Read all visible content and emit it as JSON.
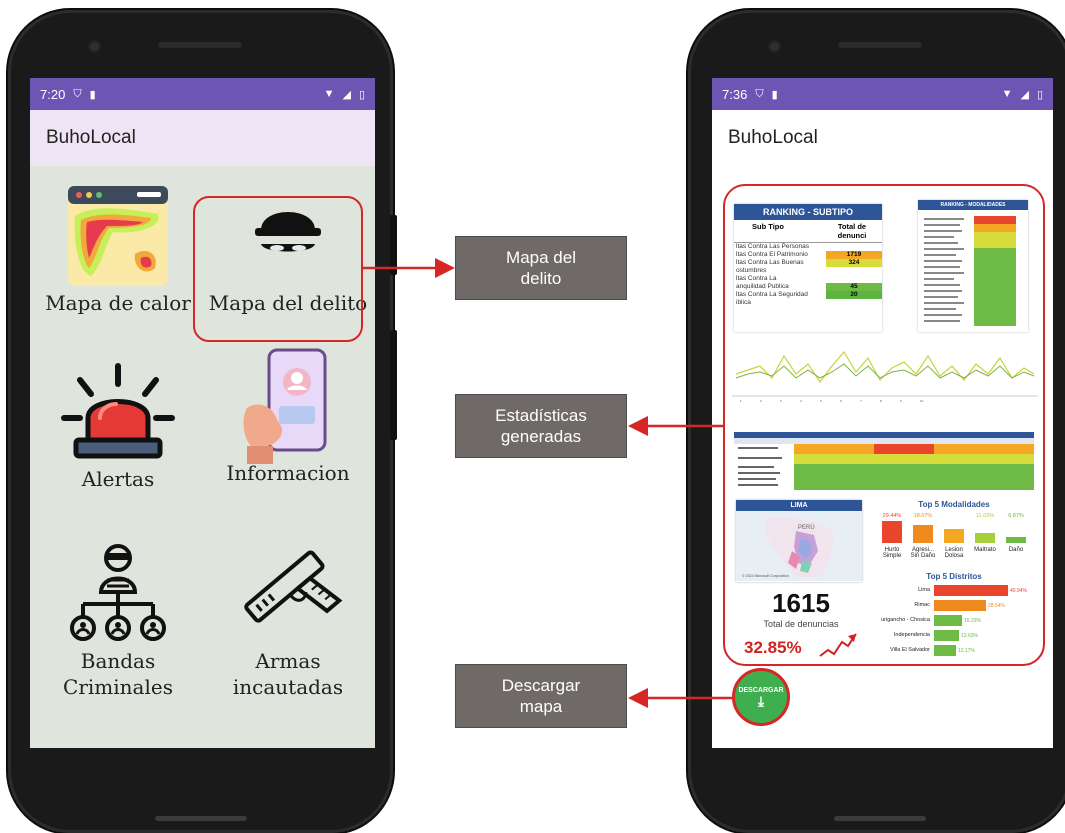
{
  "left_phone": {
    "status_time": "7:20",
    "app_title": "BuhoLocal",
    "tiles": [
      {
        "label": "Mapa de calor",
        "icon": "heatmap-icon"
      },
      {
        "label": "Mapa del delito",
        "icon": "thief-icon"
      },
      {
        "label": "Alertas",
        "icon": "siren-icon"
      },
      {
        "label": "Informacion",
        "icon": "phone-profile-icon"
      },
      {
        "label_line1": "Bandas",
        "label_line2": "Criminales",
        "icon": "gang-network-icon"
      },
      {
        "label_line1": "Armas",
        "label_line2": "incautadas",
        "icon": "pistol-icon"
      }
    ]
  },
  "right_phone": {
    "status_time": "7:36",
    "app_title": "BuhoLocal",
    "dashboard": {
      "ranking_subtipo": {
        "title": "RANKING - SUBTIPO",
        "col_subtipo": "Sub Tipo",
        "col_total": "Total de denunci",
        "rows": [
          {
            "name": "ltas Contra Las Personas",
            "value": "",
            "color": "#e8452c"
          },
          {
            "name": "ltas Contra El Patrimonio",
            "value": "1719",
            "color": "#f5a623"
          },
          {
            "name": "ltas Contra Las Buenas",
            "value": "324",
            "color": "#d6dc3b"
          },
          {
            "name": "ostumbres",
            "value": "",
            "color": "#8bc34a"
          },
          {
            "name": "ltas Contra La",
            "value": "",
            "color": "#6dbb45"
          },
          {
            "name": "anquilidad Publica",
            "value": "45",
            "color": "#6dbb45"
          },
          {
            "name": "ltas Contra La Seguridad",
            "value": "20",
            "color": "#5fb343"
          },
          {
            "name": "iblica",
            "value": "",
            "color": "#5fb343"
          }
        ]
      },
      "ranking_modalidades": {
        "title": "RANKING - MODALIDADES"
      },
      "lima_card": {
        "title": "LIMA",
        "map_label": "PERÚ",
        "map_credit": "© 2024 Microsoft Corporation"
      },
      "total_count": "1615",
      "total_label": "Total de denuncias",
      "percent": "32.85%",
      "top5_modalidades": {
        "title": "Top 5 Modalidades",
        "bars": [
          {
            "label": "Hurto Simple",
            "pct": "29.44%",
            "color": "#e8452c"
          },
          {
            "label": "Agresi... Sin Daño",
            "pct": "18.07%",
            "color": "#f08a1c"
          },
          {
            "label": "Lesion Dolosa",
            "pct": "",
            "color": "#f5a623"
          },
          {
            "label": "Maltrato",
            "pct": "11.03%",
            "color": "#a5cf3c"
          },
          {
            "label": "Daño",
            "pct": "6.87%",
            "color": "#6dbb45"
          }
        ]
      },
      "top5_distritos": {
        "title": "Top 5 Distritos",
        "bars": [
          {
            "label": "Lima",
            "pct": "40.94%",
            "value": 40.94,
            "color": "#e8452c"
          },
          {
            "label": "Rimac",
            "pct": "28.54%",
            "value": 28.54,
            "color": "#f08a1c"
          },
          {
            "label": "urigancho - Chosica",
            "pct": "15.23%",
            "value": 15.23,
            "color": "#6dbb45"
          },
          {
            "label": "Independencia",
            "pct": "13.63%",
            "value": 13.63,
            "color": "#6dbb45"
          },
          {
            "label": "Villa El Salvador",
            "pct": "12.17%",
            "value": 12.17,
            "color": "#6dbb45"
          }
        ]
      }
    },
    "fab_label": "DESCARGAR"
  },
  "callouts": {
    "mapa_line1": "Mapa del",
    "mapa_line2": "delito",
    "stats_line1": "Estadísticas",
    "stats_line2": "generadas",
    "download_line1": "Descargar",
    "download_line2": "mapa"
  },
  "colors": {
    "status_bar": "#6d55b3",
    "app_bar": "#efe4f6",
    "highlight": "#d62626",
    "callout_bg": "#6f6a67",
    "tile_bg": "#dfe4dc"
  }
}
